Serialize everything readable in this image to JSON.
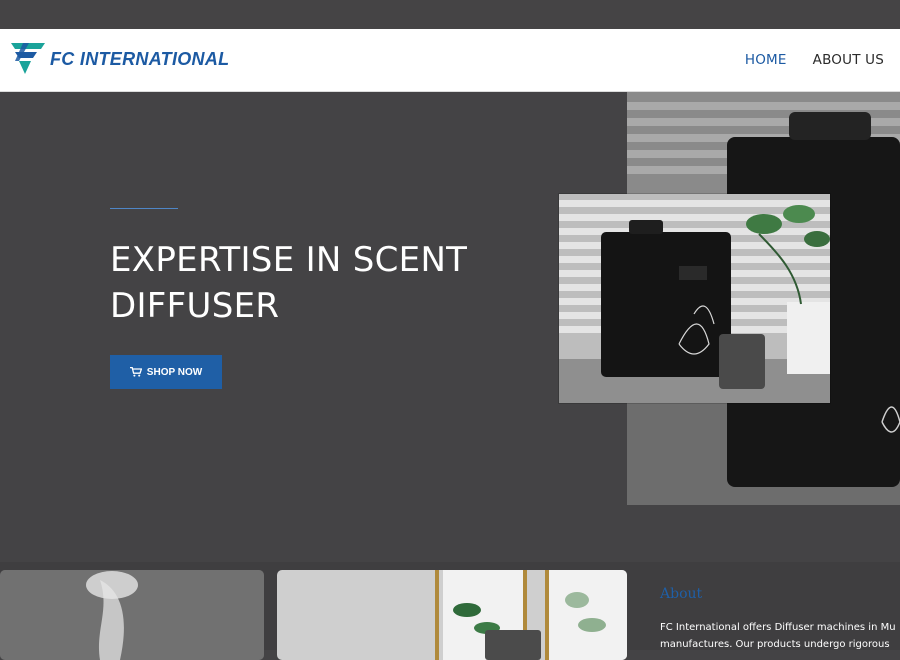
{
  "brand": {
    "name": "FC INTERNATIONAL"
  },
  "nav": {
    "items": [
      {
        "label": "HOME",
        "active": true
      },
      {
        "label": "ABOUT US",
        "active": false
      }
    ]
  },
  "hero": {
    "title": "EXPERTISE IN SCENT DIFFUSER",
    "cta_label": "SHOP NOW",
    "cta_icon": "shopping-cart-icon"
  },
  "about": {
    "heading": "About",
    "line1": "FC International offers Diffuser machines in Mu",
    "line2": "manufactures.  Our products undergo rigorous"
  },
  "colors": {
    "accent": "#1f5fa6",
    "background": "#444345",
    "navbar": "#ffffff"
  }
}
